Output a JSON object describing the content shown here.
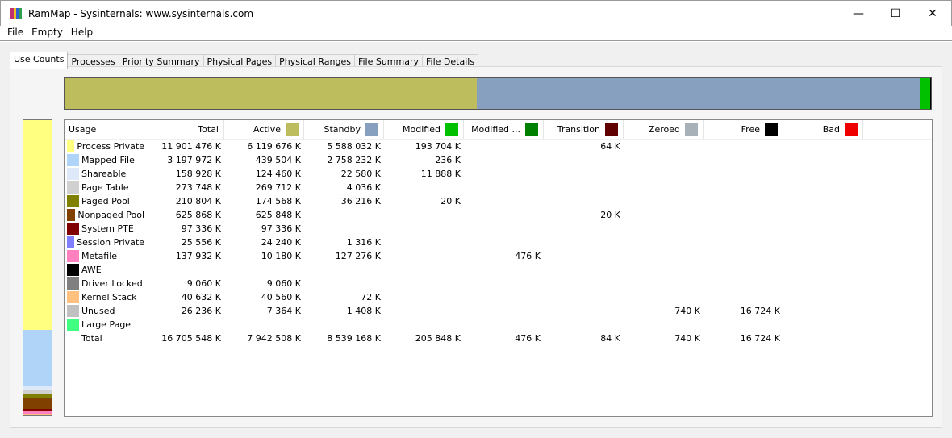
{
  "window": {
    "title": "RamMap - Sysinternals: www.sysinternals.com",
    "minimize": "—",
    "maximize": "☐",
    "close": "✕"
  },
  "menu": [
    "File",
    "Empty",
    "Help"
  ],
  "tabs": [
    "Use Counts",
    "Processes",
    "Priority Summary",
    "Physical Pages",
    "Physical Ranges",
    "File Summary",
    "File Details"
  ],
  "columns": [
    {
      "label": "Usage"
    },
    {
      "label": "Total"
    },
    {
      "label": "Active",
      "color": "#bdbd5e"
    },
    {
      "label": "Standby",
      "color": "#87a0bf"
    },
    {
      "label": "Modified",
      "color": "#00c000"
    },
    {
      "label": "Modified ...",
      "color": "#008000"
    },
    {
      "label": "Transition",
      "color": "#600000"
    },
    {
      "label": "Zeroed",
      "color": "#a8b0b8"
    },
    {
      "label": "Free",
      "color": "#000000"
    },
    {
      "label": "Bad",
      "color": "#ee0000"
    }
  ],
  "rows": [
    {
      "name": "Process Private",
      "color": "#ffff80",
      "total_k": 11901476,
      "values": [
        "11 901 476 K",
        "6 119 676 K",
        "5 588 032 K",
        "193 704 K",
        "",
        "64 K",
        "",
        "",
        ""
      ]
    },
    {
      "name": "Mapped File",
      "color": "#b0d4f8",
      "total_k": 3197972,
      "values": [
        "3 197 972 K",
        "439 504 K",
        "2 758 232 K",
        "236 K",
        "",
        "",
        "",
        "",
        ""
      ]
    },
    {
      "name": "Shareable",
      "color": "#dde8f8",
      "total_k": 158928,
      "values": [
        "158 928 K",
        "124 460 K",
        "22 580 K",
        "11 888 K",
        "",
        "",
        "",
        "",
        ""
      ]
    },
    {
      "name": "Page Table",
      "color": "#d0d0d0",
      "total_k": 273748,
      "values": [
        "273 748 K",
        "269 712 K",
        "4 036 K",
        "",
        "",
        "",
        "",
        "",
        ""
      ]
    },
    {
      "name": "Paged Pool",
      "color": "#808000",
      "total_k": 210804,
      "values": [
        "210 804 K",
        "174 568 K",
        "36 216 K",
        "20 K",
        "",
        "",
        "",
        "",
        ""
      ]
    },
    {
      "name": "Nonpaged Pool",
      "color": "#804000",
      "total_k": 625868,
      "values": [
        "625 868 K",
        "625 848 K",
        "",
        "",
        "",
        "20 K",
        "",
        "",
        ""
      ]
    },
    {
      "name": "System PTE",
      "color": "#800000",
      "total_k": 97336,
      "values": [
        "97 336 K",
        "97 336 K",
        "",
        "",
        "",
        "",
        "",
        "",
        ""
      ]
    },
    {
      "name": "Session Private",
      "color": "#8080ff",
      "total_k": 25556,
      "values": [
        "25 556 K",
        "24 240 K",
        "1 316 K",
        "",
        "",
        "",
        "",
        "",
        ""
      ]
    },
    {
      "name": "Metafile",
      "color": "#ff80c0",
      "total_k": 137932,
      "values": [
        "137 932 K",
        "10 180 K",
        "127 276 K",
        "",
        "476 K",
        "",
        "",
        "",
        ""
      ]
    },
    {
      "name": "AWE",
      "color": "#000000",
      "total_k": 0,
      "values": [
        "",
        "",
        "",
        "",
        "",
        "",
        "",
        "",
        ""
      ]
    },
    {
      "name": "Driver Locked",
      "color": "#808080",
      "total_k": 9060,
      "values": [
        "9 060 K",
        "9 060 K",
        "",
        "",
        "",
        "",
        "",
        "",
        ""
      ]
    },
    {
      "name": "Kernel Stack",
      "color": "#ffc080",
      "total_k": 40632,
      "values": [
        "40 632 K",
        "40 560 K",
        "72 K",
        "",
        "",
        "",
        "",
        "",
        ""
      ]
    },
    {
      "name": "Unused",
      "color": "#c0c0c0",
      "total_k": 26236,
      "values": [
        "26 236 K",
        "7 364 K",
        "1 408 K",
        "",
        "",
        "",
        "740 K",
        "16 724 K",
        ""
      ]
    },
    {
      "name": "Large Page",
      "color": "#40ff80",
      "total_k": 0,
      "values": [
        "",
        "",
        "",
        "",
        "",
        "",
        "",
        "",
        ""
      ]
    }
  ],
  "total": {
    "name": "Total",
    "values": [
      "16 705 548 K",
      "7 942 508 K",
      "8 539 168 K",
      "205 848 K",
      "476 K",
      "84 K",
      "740 K",
      "16 724 K",
      ""
    ]
  },
  "state_totals_k": [
    7942508,
    8539168,
    205848,
    476,
    84,
    740,
    16724,
    0
  ]
}
